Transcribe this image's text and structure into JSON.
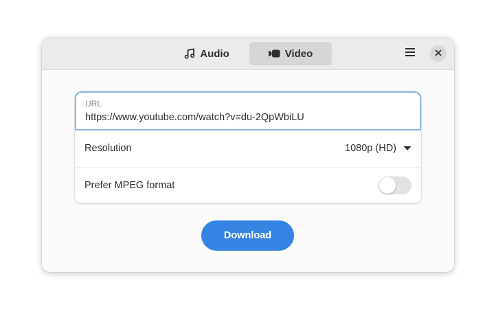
{
  "header": {
    "tabs": [
      {
        "label": "Audio",
        "icon": "music-note-icon",
        "active": false
      },
      {
        "label": "Video",
        "icon": "video-camera-icon",
        "active": true
      }
    ],
    "menu_icon": "hamburger-menu-icon",
    "close_icon": "close-icon"
  },
  "form": {
    "url": {
      "label": "URL",
      "value": "https://www.youtube.com/watch?v=du-2QpWbiLU"
    },
    "resolution": {
      "label": "Resolution",
      "selected": "1080p (HD)"
    },
    "prefer_mpeg": {
      "label": "Prefer MPEG format",
      "enabled": false
    }
  },
  "actions": {
    "download_label": "Download"
  },
  "colors": {
    "accent": "#3584e4",
    "focus_border": "#8fb4e3",
    "headerbar": "#ebebeb",
    "active_tab": "#d6d6d6"
  }
}
